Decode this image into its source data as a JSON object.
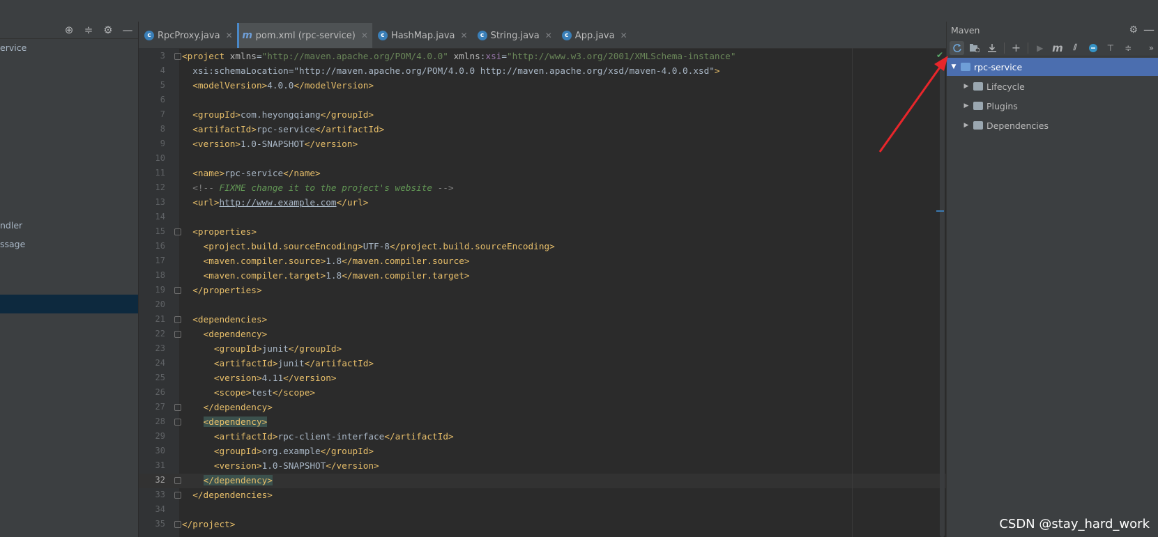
{
  "project_panel": {
    "items": [
      {
        "label": "ervice"
      },
      {
        "label": "ndler"
      },
      {
        "label": "ssage"
      }
    ]
  },
  "tabs": [
    {
      "label": "RpcProxy.java",
      "icon": "class-icon",
      "active": false
    },
    {
      "label": "pom.xml (rpc-service)",
      "icon": "maven-icon",
      "active": true
    },
    {
      "label": "HashMap.java",
      "icon": "class-icon",
      "active": false
    },
    {
      "label": "String.java",
      "icon": "class-icon",
      "active": false
    },
    {
      "label": "App.java",
      "icon": "class-icon",
      "active": false
    }
  ],
  "editor": {
    "current_line": "32",
    "lines": [
      {
        "n": "3",
        "text": "<project xmlns=\"http://maven.apache.org/POM/4.0.0\" xmlns:xsi=\"http://www.w3.org/2001/XMLSchema-instance\""
      },
      {
        "n": "4",
        "text": "  xsi:schemaLocation=\"http://maven.apache.org/POM/4.0.0 http://maven.apache.org/xsd/maven-4.0.0.xsd\">"
      },
      {
        "n": "5",
        "text": "  <modelVersion>4.0.0</modelVersion>"
      },
      {
        "n": "6",
        "text": ""
      },
      {
        "n": "7",
        "text": "  <groupId>com.heyongqiang</groupId>"
      },
      {
        "n": "8",
        "text": "  <artifactId>rpc-service</artifactId>"
      },
      {
        "n": "9",
        "text": "  <version>1.0-SNAPSHOT</version>"
      },
      {
        "n": "10",
        "text": ""
      },
      {
        "n": "11",
        "text": "  <name>rpc-service</name>"
      },
      {
        "n": "12",
        "text": "  <!-- FIXME change it to the project's website -->"
      },
      {
        "n": "13",
        "text": "  <url>http://www.example.com</url>"
      },
      {
        "n": "14",
        "text": ""
      },
      {
        "n": "15",
        "text": "  <properties>"
      },
      {
        "n": "16",
        "text": "    <project.build.sourceEncoding>UTF-8</project.build.sourceEncoding>"
      },
      {
        "n": "17",
        "text": "    <maven.compiler.source>1.8</maven.compiler.source>"
      },
      {
        "n": "18",
        "text": "    <maven.compiler.target>1.8</maven.compiler.target>"
      },
      {
        "n": "19",
        "text": "  </properties>"
      },
      {
        "n": "20",
        "text": ""
      },
      {
        "n": "21",
        "text": "  <dependencies>"
      },
      {
        "n": "22",
        "text": "    <dependency>"
      },
      {
        "n": "23",
        "text": "      <groupId>junit</groupId>"
      },
      {
        "n": "24",
        "text": "      <artifactId>junit</artifactId>"
      },
      {
        "n": "25",
        "text": "      <version>4.11</version>"
      },
      {
        "n": "26",
        "text": "      <scope>test</scope>"
      },
      {
        "n": "27",
        "text": "    </dependency>"
      },
      {
        "n": "28",
        "text": "    <dependency>"
      },
      {
        "n": "29",
        "text": "      <artifactId>rpc-client-interface</artifactId>"
      },
      {
        "n": "30",
        "text": "      <groupId>org.example</groupId>"
      },
      {
        "n": "31",
        "text": "      <version>1.0-SNAPSHOT</version>"
      },
      {
        "n": "32",
        "text": "    </dependency>"
      },
      {
        "n": "33",
        "text": "  </dependencies>"
      },
      {
        "n": "34",
        "text": ""
      },
      {
        "n": "35",
        "text": "</project>"
      }
    ]
  },
  "maven": {
    "title": "Maven",
    "toolbar": [
      {
        "icon": "reload-icon",
        "label": "Reload All Maven Projects"
      },
      {
        "icon": "generate-sources-icon",
        "label": "Generate Sources"
      },
      {
        "icon": "download-icon",
        "label": "Download Sources"
      },
      {
        "icon": "add-icon",
        "label": "Add Maven Projects"
      },
      {
        "icon": "run-icon",
        "label": "Run Maven Build"
      },
      {
        "icon": "execute-goal-icon",
        "label": "Execute Maven Goal"
      },
      {
        "icon": "skip-tests-icon",
        "label": "Toggle Skip Tests"
      },
      {
        "icon": "offline-icon",
        "label": "Toggle Offline Mode"
      },
      {
        "icon": "show-deps-icon",
        "label": "Show Dependencies"
      },
      {
        "icon": "collapse-icon",
        "label": "Collapse All"
      }
    ],
    "tree": [
      {
        "label": "rpc-service",
        "expanded": true,
        "selected": true,
        "level": 0
      },
      {
        "label": "Lifecycle",
        "expanded": false,
        "selected": false,
        "level": 1
      },
      {
        "label": "Plugins",
        "expanded": false,
        "selected": false,
        "level": 1
      },
      {
        "label": "Dependencies",
        "expanded": false,
        "selected": false,
        "level": 1
      }
    ]
  },
  "watermark": "CSDN @stay_hard_work",
  "colors": {
    "accent": "#4b6eaf",
    "tag": "#e8bf6a",
    "attr_value": "#6a8759",
    "annotation_arrow": "#e8262b"
  }
}
